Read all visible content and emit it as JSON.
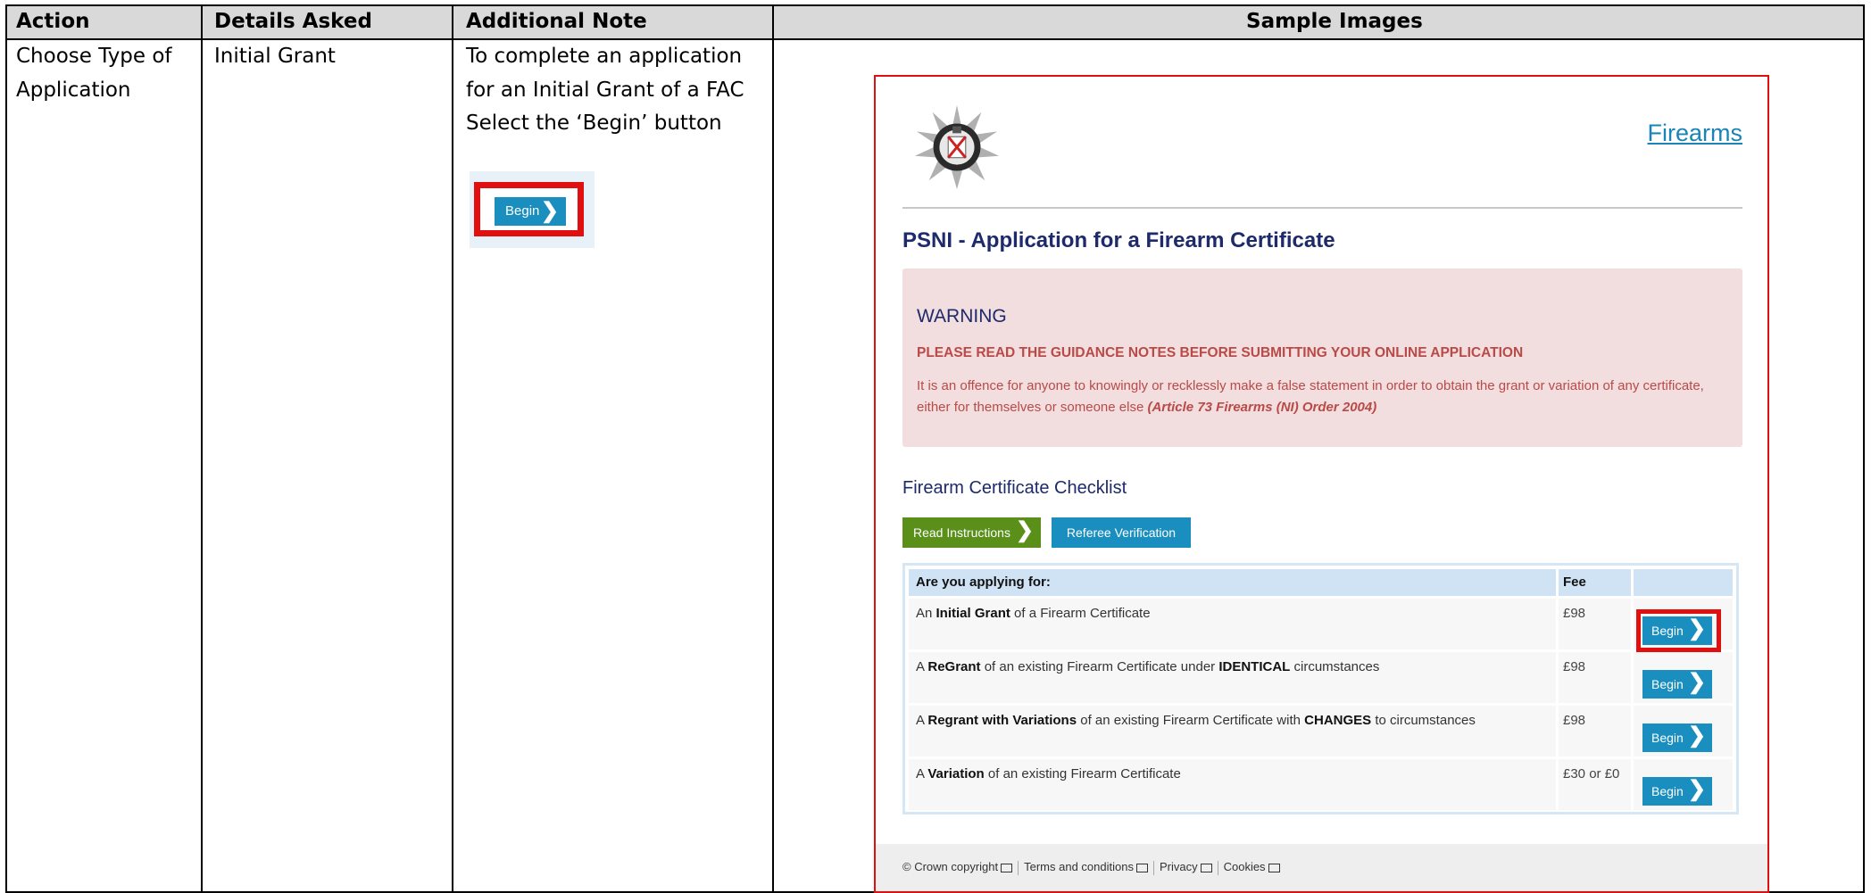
{
  "table": {
    "headers": [
      "Action",
      "Details Asked",
      "Additional Note",
      "Sample Images"
    ],
    "row": {
      "action_lines": [
        "Choose Type of",
        "Application"
      ],
      "details": "Initial Grant",
      "note_lines": [
        "To complete an application",
        "for an Initial Grant of a FAC",
        "Select the ‘Begin’ button"
      ],
      "sample_begin_label": "Begin"
    }
  },
  "screenshot": {
    "site_link": "Firearms",
    "page_title": "PSNI - Application for a Firearm Certificate",
    "warning": {
      "heading": "WARNING",
      "caps": "PLEASE READ THE GUIDANCE NOTES BEFORE SUBMITTING YOUR ONLINE APPLICATION",
      "text": "It is an offence for anyone to knowingly or recklessly make a false statement in order to obtain the grant or variation of any certificate, either for themselves or someone else",
      "citation": "(Article 73 Firearms (NI) Order 2004)"
    },
    "checklist_title": "Firearm Certificate Checklist",
    "read_instructions": "Read Instructions",
    "referee_verification": "Referee Verification",
    "grid": {
      "col_question": "Are you applying for:",
      "col_fee": "Fee",
      "rows": [
        {
          "pre": "An ",
          "bold": "Initial Grant",
          "post": " of a Firearm Certificate",
          "bold2": "",
          "post2": "",
          "fee": "£98",
          "button": "Begin"
        },
        {
          "pre": "A ",
          "bold": "ReGrant",
          "post": " of an existing Firearm Certificate under ",
          "bold2": "IDENTICAL",
          "post2": " circumstances",
          "fee": "£98",
          "button": "Begin"
        },
        {
          "pre": "A ",
          "bold": "Regrant with Variations",
          "post": " of an existing Firearm Certificate with ",
          "bold2": "CHANGES",
          "post2": " to circumstances",
          "fee": "£98",
          "button": "Begin"
        },
        {
          "pre": "A ",
          "bold": "Variation",
          "post": " of an existing Firearm Certificate",
          "bold2": "",
          "post2": "",
          "fee": "£30 or £0",
          "button": "Begin"
        }
      ]
    },
    "footer": {
      "copyright": "© Crown copyright",
      "terms": "Terms and conditions",
      "privacy": "Privacy",
      "cookies": "Cookies"
    },
    "colors": {
      "accent_blue": "#1a8fbf",
      "green": "#5a8f1a",
      "title_navy": "#1d2a6b",
      "warning_red": "#b94a48",
      "highlight_red": "#e01010"
    },
    "icons": [
      "psni-badge-icon",
      "chevron-right-icon",
      "external-link-icon"
    ]
  }
}
